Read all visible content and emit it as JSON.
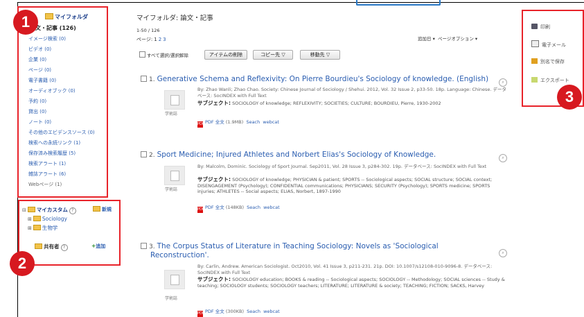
{
  "badges": [
    "1",
    "2",
    "3"
  ],
  "left_nav": {
    "title": "マイフォルダ",
    "items": [
      {
        "label": "論文・記事 (126)",
        "active": true
      },
      {
        "label": "イメージ検索 (0)"
      },
      {
        "label": "ビデオ (0)"
      },
      {
        "label": "企業 (0)"
      },
      {
        "label": "ページ (0)"
      },
      {
        "label": "電子書籍 (0)"
      },
      {
        "label": "オーディオブック (0)"
      },
      {
        "label": "予約 (0)"
      },
      {
        "label": "貸出 (0)"
      },
      {
        "label": "ノート (0)"
      },
      {
        "label": "その他のエビデンスソース (0)"
      },
      {
        "label": "検索への永続リンク (1)"
      },
      {
        "label": "保存済み検索履歴 (5)"
      },
      {
        "label": "検索アラート (1)"
      },
      {
        "label": "雑誌アラート (6)"
      },
      {
        "label": "Webページ (1)"
      }
    ]
  },
  "custom": {
    "title": "マイカスタム",
    "new_label": "新規",
    "folders": [
      "Sociology",
      "生物学"
    ],
    "shared_label": "共有者",
    "add_label": "追加"
  },
  "main": {
    "title": "マイフォルダ: 論文・記事",
    "range": "1-50 / 126",
    "pages_label": "ページ:",
    "pages": [
      "1",
      "2",
      "3"
    ],
    "sort_label": "追加日 ▾",
    "page_options": "ページオプション ▾",
    "select_all": "すべて選択/選択解除",
    "buttons": {
      "delete": "アイテムの削除",
      "copy": "コピー先 ▽",
      "move": "移動先 ▽"
    }
  },
  "results": [
    {
      "num": "1.",
      "title": "Generative Schema and Reflexivity: On Pierre Bourdieu's Sociology of knowledge. (English)",
      "meta": "By: Zhao Wanli; Zhao Chao. Society: Chinese Journal of Sociology / Shehui. 2012, Vol. 32 Issue 2, p33-50. 18p. Language: Chinese. データベース: SocINDEX with Full Text",
      "subject_label": "サブジェクト:",
      "subjects": "SOCIOLOGY of knowledge; REFLEXIVITY; SOCIETIES; CULTURE; BOURDIEU, Pierre, 1930-2002",
      "thumb_label": "学術誌",
      "pdf_label": "PDF 全文",
      "pdf_size": "(1.9MB)",
      "links": [
        "Seach",
        "webcat"
      ]
    },
    {
      "num": "2.",
      "title": "Sport Medicine; Injured Athletes and Norbert Elias's Sociology of Knowledge.",
      "meta": "By: Malcolm, Dominic. Sociology of Sport Journal. Sep2011, Vol. 28 Issue 3, p284-302. 19p. データベース: SocINDEX with Full Text",
      "subject_label": "サブジェクト:",
      "subjects": "SOCIOLOGY of knowledge; PHYSICIAN & patient; SPORTS -- Sociological aspects; SOCIAL structure; SOCIAL context; DISENGAGEMENT (Psychology); CONFIDENTIAL communications; PHYSICIANS; SECURITY (Psychology); SPORTS medicine; SPORTS injuries; ATHLETES -- Social aspects; ELIAS, Norbert, 1897-1990",
      "thumb_label": "学術誌",
      "pdf_label": "PDF 全文",
      "pdf_size": "(148KB)",
      "links": [
        "Seach",
        "webcat"
      ]
    },
    {
      "num": "3.",
      "title": "The Corpus Status of Literature in Teaching Sociology: Novels as 'Sociological",
      "title2": "Reconstruction'.",
      "meta": "By: Carlin, Andrew. American Sociologist. Oct2010, Vol. 41 Issue 3, p211-231. 21p. DOI: 10.1007/s12108-010-9096-8. データベース: SocINDEX with Full Text",
      "subject_label": "サブジェクト:",
      "subjects": "SOCIOLOGY education; BOOKS & reading -- Sociological aspects; SOCIOLOGY -- Methodology; SOCIAL sciences -- Study & teaching; SOCIOLOGY students; SOCIOLOGY teachers; LITERATURE; LITERATURE & society; TEACHING; FICTION; SACKS, Harvey",
      "thumb_label": "学術誌",
      "pdf_label": "PDF 全文",
      "pdf_size": "(300KB)",
      "links": [
        "Seach",
        "webcat"
      ]
    }
  ],
  "right_tools": [
    "印刷",
    "電子メール",
    "別名で保存",
    "エクスポート"
  ],
  "colors": {
    "accent": "#2a5db0",
    "badge": "#d71920",
    "highlight_box": "#e8232a"
  }
}
